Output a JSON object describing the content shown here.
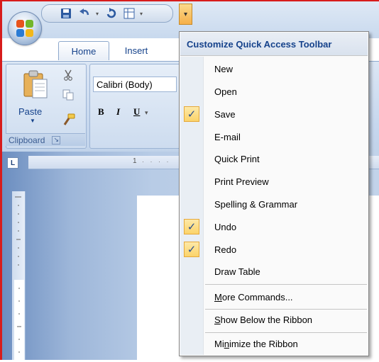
{
  "tabs": {
    "home": "Home",
    "insert": "Insert"
  },
  "ribbon": {
    "paste": "Paste",
    "clipboard": "Clipboard",
    "font_name": "Calibri (Body)",
    "bold": "B",
    "italic": "I",
    "underline": "U",
    "ruler_corner": "L",
    "ruler_number": "1"
  },
  "menu": {
    "title": "Customize Quick Access Toolbar",
    "items": [
      {
        "label": "New",
        "checked": false
      },
      {
        "label": "Open",
        "checked": false
      },
      {
        "label": "Save",
        "checked": true
      },
      {
        "label": "E-mail",
        "checked": false
      },
      {
        "label": "Quick Print",
        "checked": false
      },
      {
        "label": "Print Preview",
        "checked": false
      },
      {
        "label": "Spelling & Grammar",
        "checked": false
      },
      {
        "label": "Undo",
        "checked": true
      },
      {
        "label": "Redo",
        "checked": true
      },
      {
        "label": "Draw Table",
        "checked": false
      }
    ],
    "more_commands": {
      "pre": "",
      "u": "M",
      "post": "ore Commands..."
    },
    "show_below": {
      "pre": "",
      "u": "S",
      "post": "how Below the Ribbon"
    },
    "minimize": {
      "pre": "Mi",
      "u": "n",
      "post": "imize the Ribbon"
    }
  },
  "icons": [
    "office-button-icon",
    "save-icon",
    "undo-icon",
    "redo-icon",
    "layout-icon",
    "customize-dropdown-icon",
    "paste-icon",
    "cut-icon",
    "copy-icon",
    "format-painter-icon",
    "check-icon",
    "dialog-launcher-icon"
  ],
  "colors": {
    "accent": "#15428b",
    "check_bg": "#fbd36a",
    "frame_border": "#d71c1c"
  }
}
